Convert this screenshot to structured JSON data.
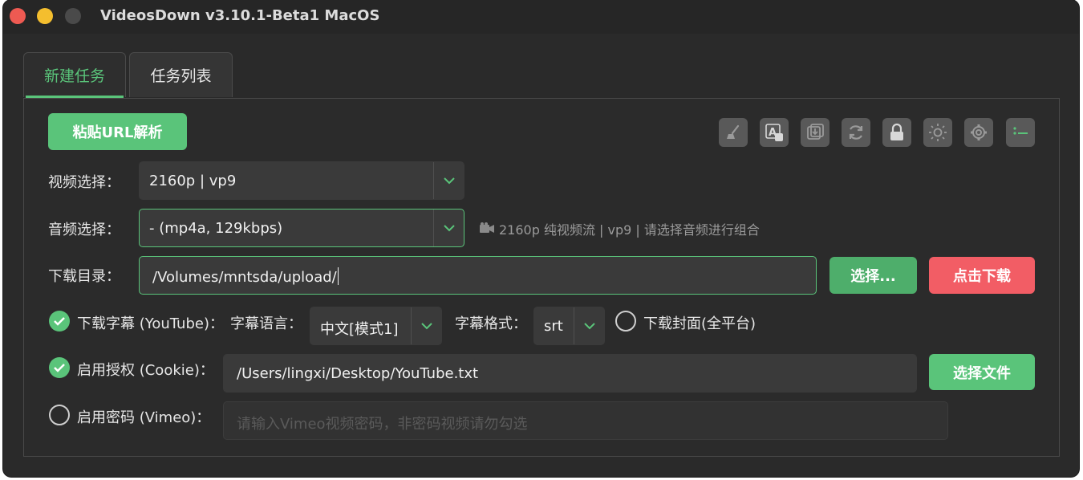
{
  "window": {
    "title": "VideosDown v3.10.1-Beta1 MacOS"
  },
  "tabs": [
    {
      "label": "新建任务",
      "active": true
    },
    {
      "label": "任务列表",
      "active": false
    }
  ],
  "toolbar": {
    "paste_button": "粘贴URL解析",
    "icons": [
      "broom-icon",
      "font-icon",
      "import-icon",
      "refresh-icon",
      "lock-icon",
      "sun-icon",
      "gear-icon",
      "list-icon"
    ]
  },
  "video": {
    "label": "视频选择：",
    "value": "2160p | vp9"
  },
  "audio": {
    "label": "音频选择：",
    "value": "- (mp4a, 129kbps)",
    "hint": "2160p 纯视频流 | vp9 | 请选择音频进行组合"
  },
  "download_dir": {
    "label": "下载目录：",
    "value": "/Volumes/mntsda/upload/",
    "choose_button": "选择...",
    "download_button": "点击下载"
  },
  "subtitles": {
    "checkbox_label": "下载字幕 (YouTube)：",
    "checked": true,
    "lang_label": "字幕语言：",
    "lang_value": "中文[模式1]",
    "format_label": "字幕格式：",
    "format_value": "srt",
    "cover_label": "下载封面(全平台)",
    "cover_checked": false
  },
  "cookie": {
    "checkbox_label": "启用授权 (Cookie)：",
    "checked": true,
    "value": "/Users/lingxi/Desktop/YouTube.txt",
    "choose_button": "选择文件"
  },
  "vimeo": {
    "checkbox_label": "启用密码 (Vimeo)：",
    "checked": false,
    "placeholder": "请输入Vimeo视频密码，非密码视频请勿勾选"
  },
  "colors": {
    "accent": "#5ac47a",
    "danger": "#f25d65",
    "background": "#2a2a2a"
  }
}
